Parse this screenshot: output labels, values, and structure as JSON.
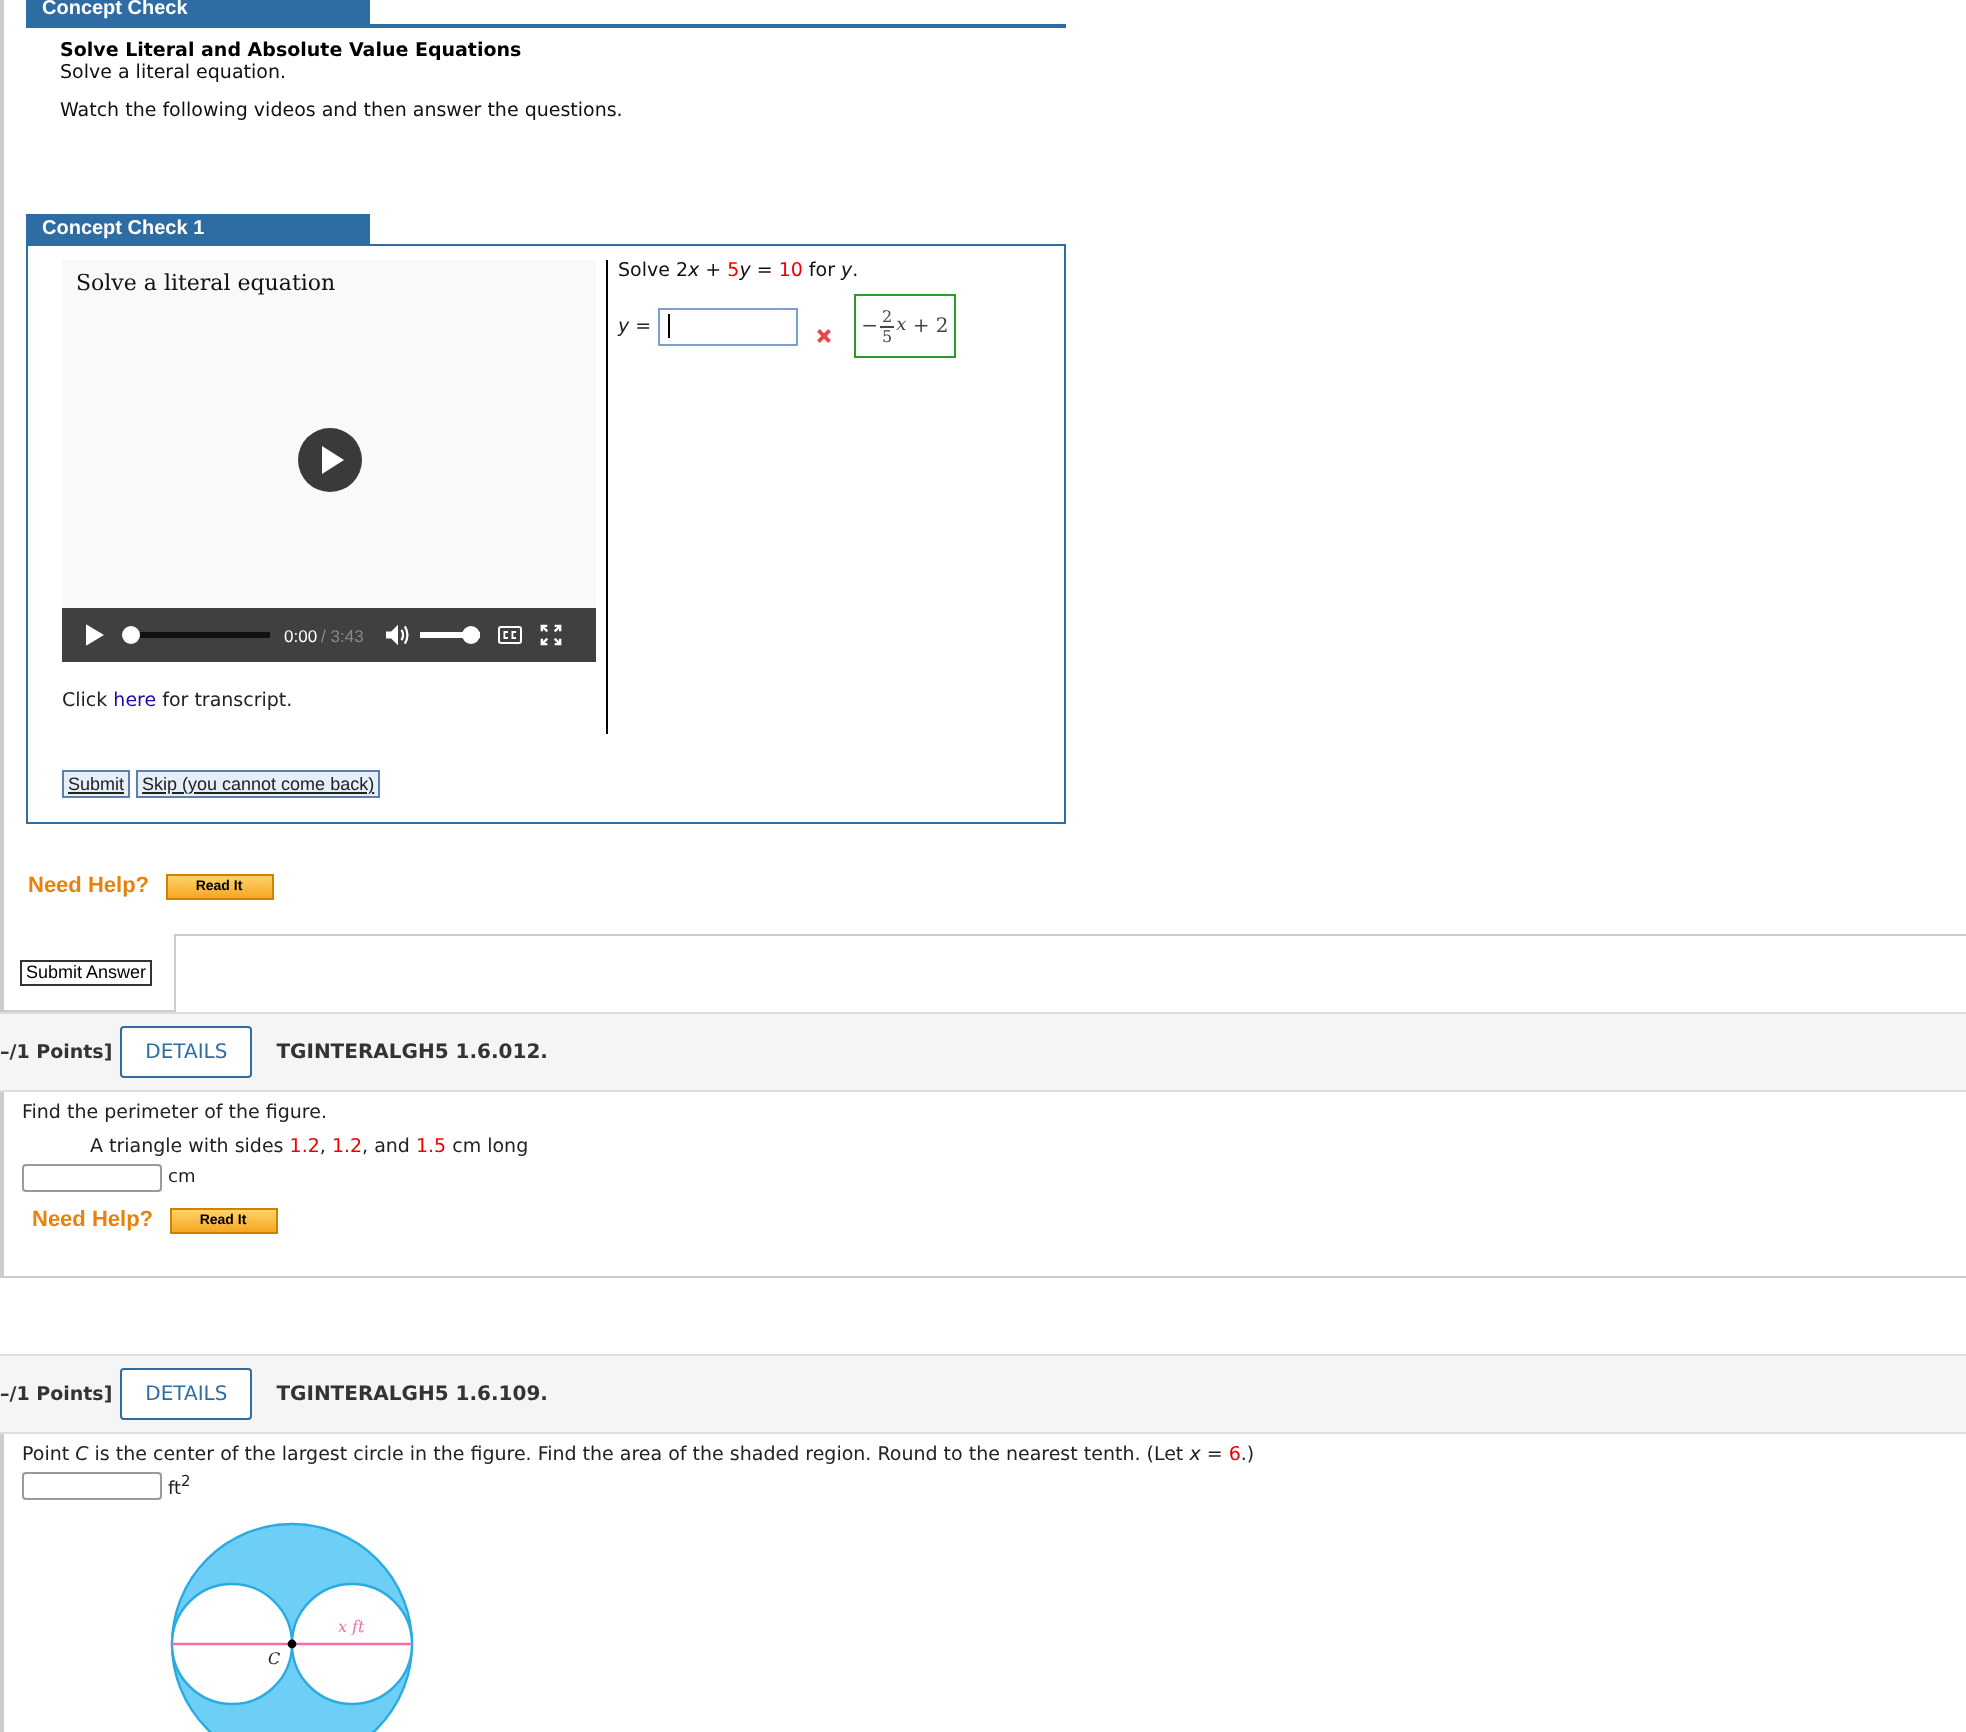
{
  "section_tab": "Concept Check",
  "intro": {
    "title": "Solve Literal and Absolute Value Equations",
    "subtitle": "Solve a literal equation.",
    "instruction": "Watch the following videos and then answer the questions."
  },
  "concept_check": {
    "tab": "Concept Check 1",
    "video": {
      "title": "Solve a literal equation",
      "time": "0:00",
      "duration": "/ 3:43",
      "progress": {
        "level": 0
      },
      "volume": {
        "level": 1
      }
    },
    "transcript": [
      {
        "text": "Click ",
        "kind": "plain"
      },
      {
        "text": "here",
        "kind": "link"
      },
      {
        "text": " for transcript.",
        "kind": "plain"
      }
    ],
    "prompt": [
      {
        "text": "Solve 2",
        "kind": "plain"
      },
      {
        "text": "x",
        "kind": "var"
      },
      {
        "text": " + ",
        "kind": "plain"
      },
      {
        "text": "5",
        "kind": "given"
      },
      {
        "text": "y",
        "kind": "var"
      },
      {
        "text": " = ",
        "kind": "plain"
      },
      {
        "text": "10",
        "kind": "given"
      },
      {
        "text": " for ",
        "kind": "plain"
      },
      {
        "text": "y",
        "kind": "var"
      },
      {
        "text": ".",
        "kind": "plain"
      }
    ],
    "answer_label": "y",
    "answer_equals": "=",
    "correct": false,
    "correct_answer": {
      "sign": "−",
      "numerator": "2",
      "denominator": "5",
      "variable": "x",
      "rest": "+ 2"
    },
    "buttons": [
      "Submit",
      "Skip (you cannot come back)"
    ]
  },
  "help_1": {
    "label": "Need Help?",
    "button": "Read It"
  },
  "submit_answer": "Submit Answer",
  "questions": [
    {
      "points": "–/1 Points]",
      "details": "DETAILS",
      "code": "TGINTERALGH5 1.6.012.",
      "text": [
        {
          "text": "Find the perimeter of the figure.",
          "kind": "plain"
        }
      ],
      "detail": [
        {
          "text": "A triangle with sides ",
          "kind": "plain"
        },
        {
          "text": "1.2",
          "kind": "given"
        },
        {
          "text": ", ",
          "kind": "plain"
        },
        {
          "text": "1.2",
          "kind": "given"
        },
        {
          "text": ", and ",
          "kind": "plain"
        },
        {
          "text": "1.5",
          "kind": "given"
        },
        {
          "text": " cm long",
          "kind": "plain"
        }
      ],
      "unit": "cm",
      "help": {
        "label": "Need Help?",
        "button": "Read It"
      }
    },
    {
      "points": "–/1 Points]",
      "details": "DETAILS",
      "code": "TGINTERALGH5 1.6.109.",
      "text": [
        {
          "text": "Point ",
          "kind": "plain"
        },
        {
          "text": "C",
          "kind": "var"
        },
        {
          "text": " is the center of the largest circle in the figure. Find the area of the shaded region. Round to the nearest tenth. (Let ",
          "kind": "plain"
        },
        {
          "text": "x",
          "kind": "var"
        },
        {
          "text": " = ",
          "kind": "plain"
        },
        {
          "text": "6",
          "kind": "given"
        },
        {
          "text": ".)",
          "kind": "plain"
        }
      ],
      "unit": "ft$^{2}$",
      "figure": {
        "length_label": "x ft",
        "center_label": "C"
      }
    }
  ]
}
